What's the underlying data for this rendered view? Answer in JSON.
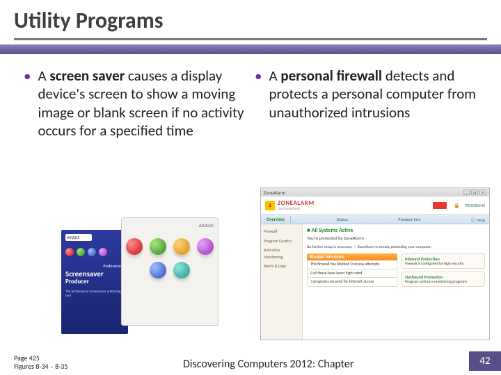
{
  "title": "Utility Programs",
  "bullets": {
    "left": {
      "bold": "screen saver",
      "before": "A ",
      "after": " causes a display device's screen to show a moving image or blank screen if no activity occurs for a specified time"
    },
    "right": {
      "bold": "personal firewall",
      "before": "A ",
      "after": " detects and protects a personal computer from unauthorized intrusions"
    }
  },
  "fig_left": {
    "brand": "AXIALIS",
    "prof": "Professional",
    "product": "Screensaver",
    "product2": "Producer",
    "tag": "The professional screensaver authoring tool"
  },
  "fig_right": {
    "titlebar": "ZoneAlarm",
    "logoZ": "Z",
    "appname": "ZONEALARM",
    "bycp": "by Check Point",
    "programs": "PROGRAMS",
    "tabs": {
      "overview": "Overview",
      "status_tab": "Status",
      "product": "Product Info",
      "help": "Help"
    },
    "side": {
      "firewall": "Firewall",
      "program": "Program Control",
      "av": "Anti-virus Monitoring",
      "alerts": "Alerts & Logs"
    },
    "status_heading": "All Systems Active",
    "blocked": "Blocked Intrusions",
    "protected": "You're protected by ZoneAlarm",
    "noconfig": "No further setup is necessary — ZoneAlarm is already protecting your computer.",
    "in_title": "Inbound Protection",
    "in1": "The firewall has blocked 0 access attempts",
    "in2": "0 of those have been high rated",
    "out_title": "Outbound Protection",
    "out1": "3 programs secured for Internet access",
    "rcard1": "Inbound Protection",
    "rcard1_sub": "Firewall is configured for high security",
    "rcard2": "Outbound Protection",
    "rcard2_sub": "Program control is monitoring programs"
  },
  "footer": {
    "page": "Page 425",
    "figs": "Figures 8-34 – 8-35",
    "source": "Discovering Computers 2012: Chapter",
    "num": "42"
  }
}
